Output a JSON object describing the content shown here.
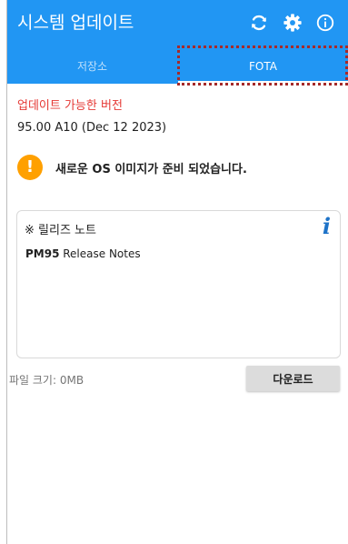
{
  "app_bar": {
    "title": "시스템 업데이트",
    "background_color": "#2196f3",
    "actions": [
      {
        "icon": "refresh-icon"
      },
      {
        "icon": "gear-icon"
      },
      {
        "icon": "info-icon"
      }
    ]
  },
  "tabs": [
    {
      "label": "저장소",
      "selected": false
    },
    {
      "label": "FOTA",
      "selected": true
    }
  ],
  "update": {
    "available_label": "업데이트 가능한 버전",
    "available_label_color": "#e53935",
    "version": "95.00 A10 (Dec 12 2023)",
    "warning_icon": "exclamation-icon",
    "warning_text": "새로운 OS 이미지가 준비 되었습니다."
  },
  "release_notes": {
    "title": "※ 릴리즈 노트",
    "info_icon": "info-italic-icon",
    "model": "PM95",
    "body_suffix": " Release Notes"
  },
  "footer": {
    "file_size": "파일 크기: 0MB",
    "download_label": "다운로드"
  }
}
